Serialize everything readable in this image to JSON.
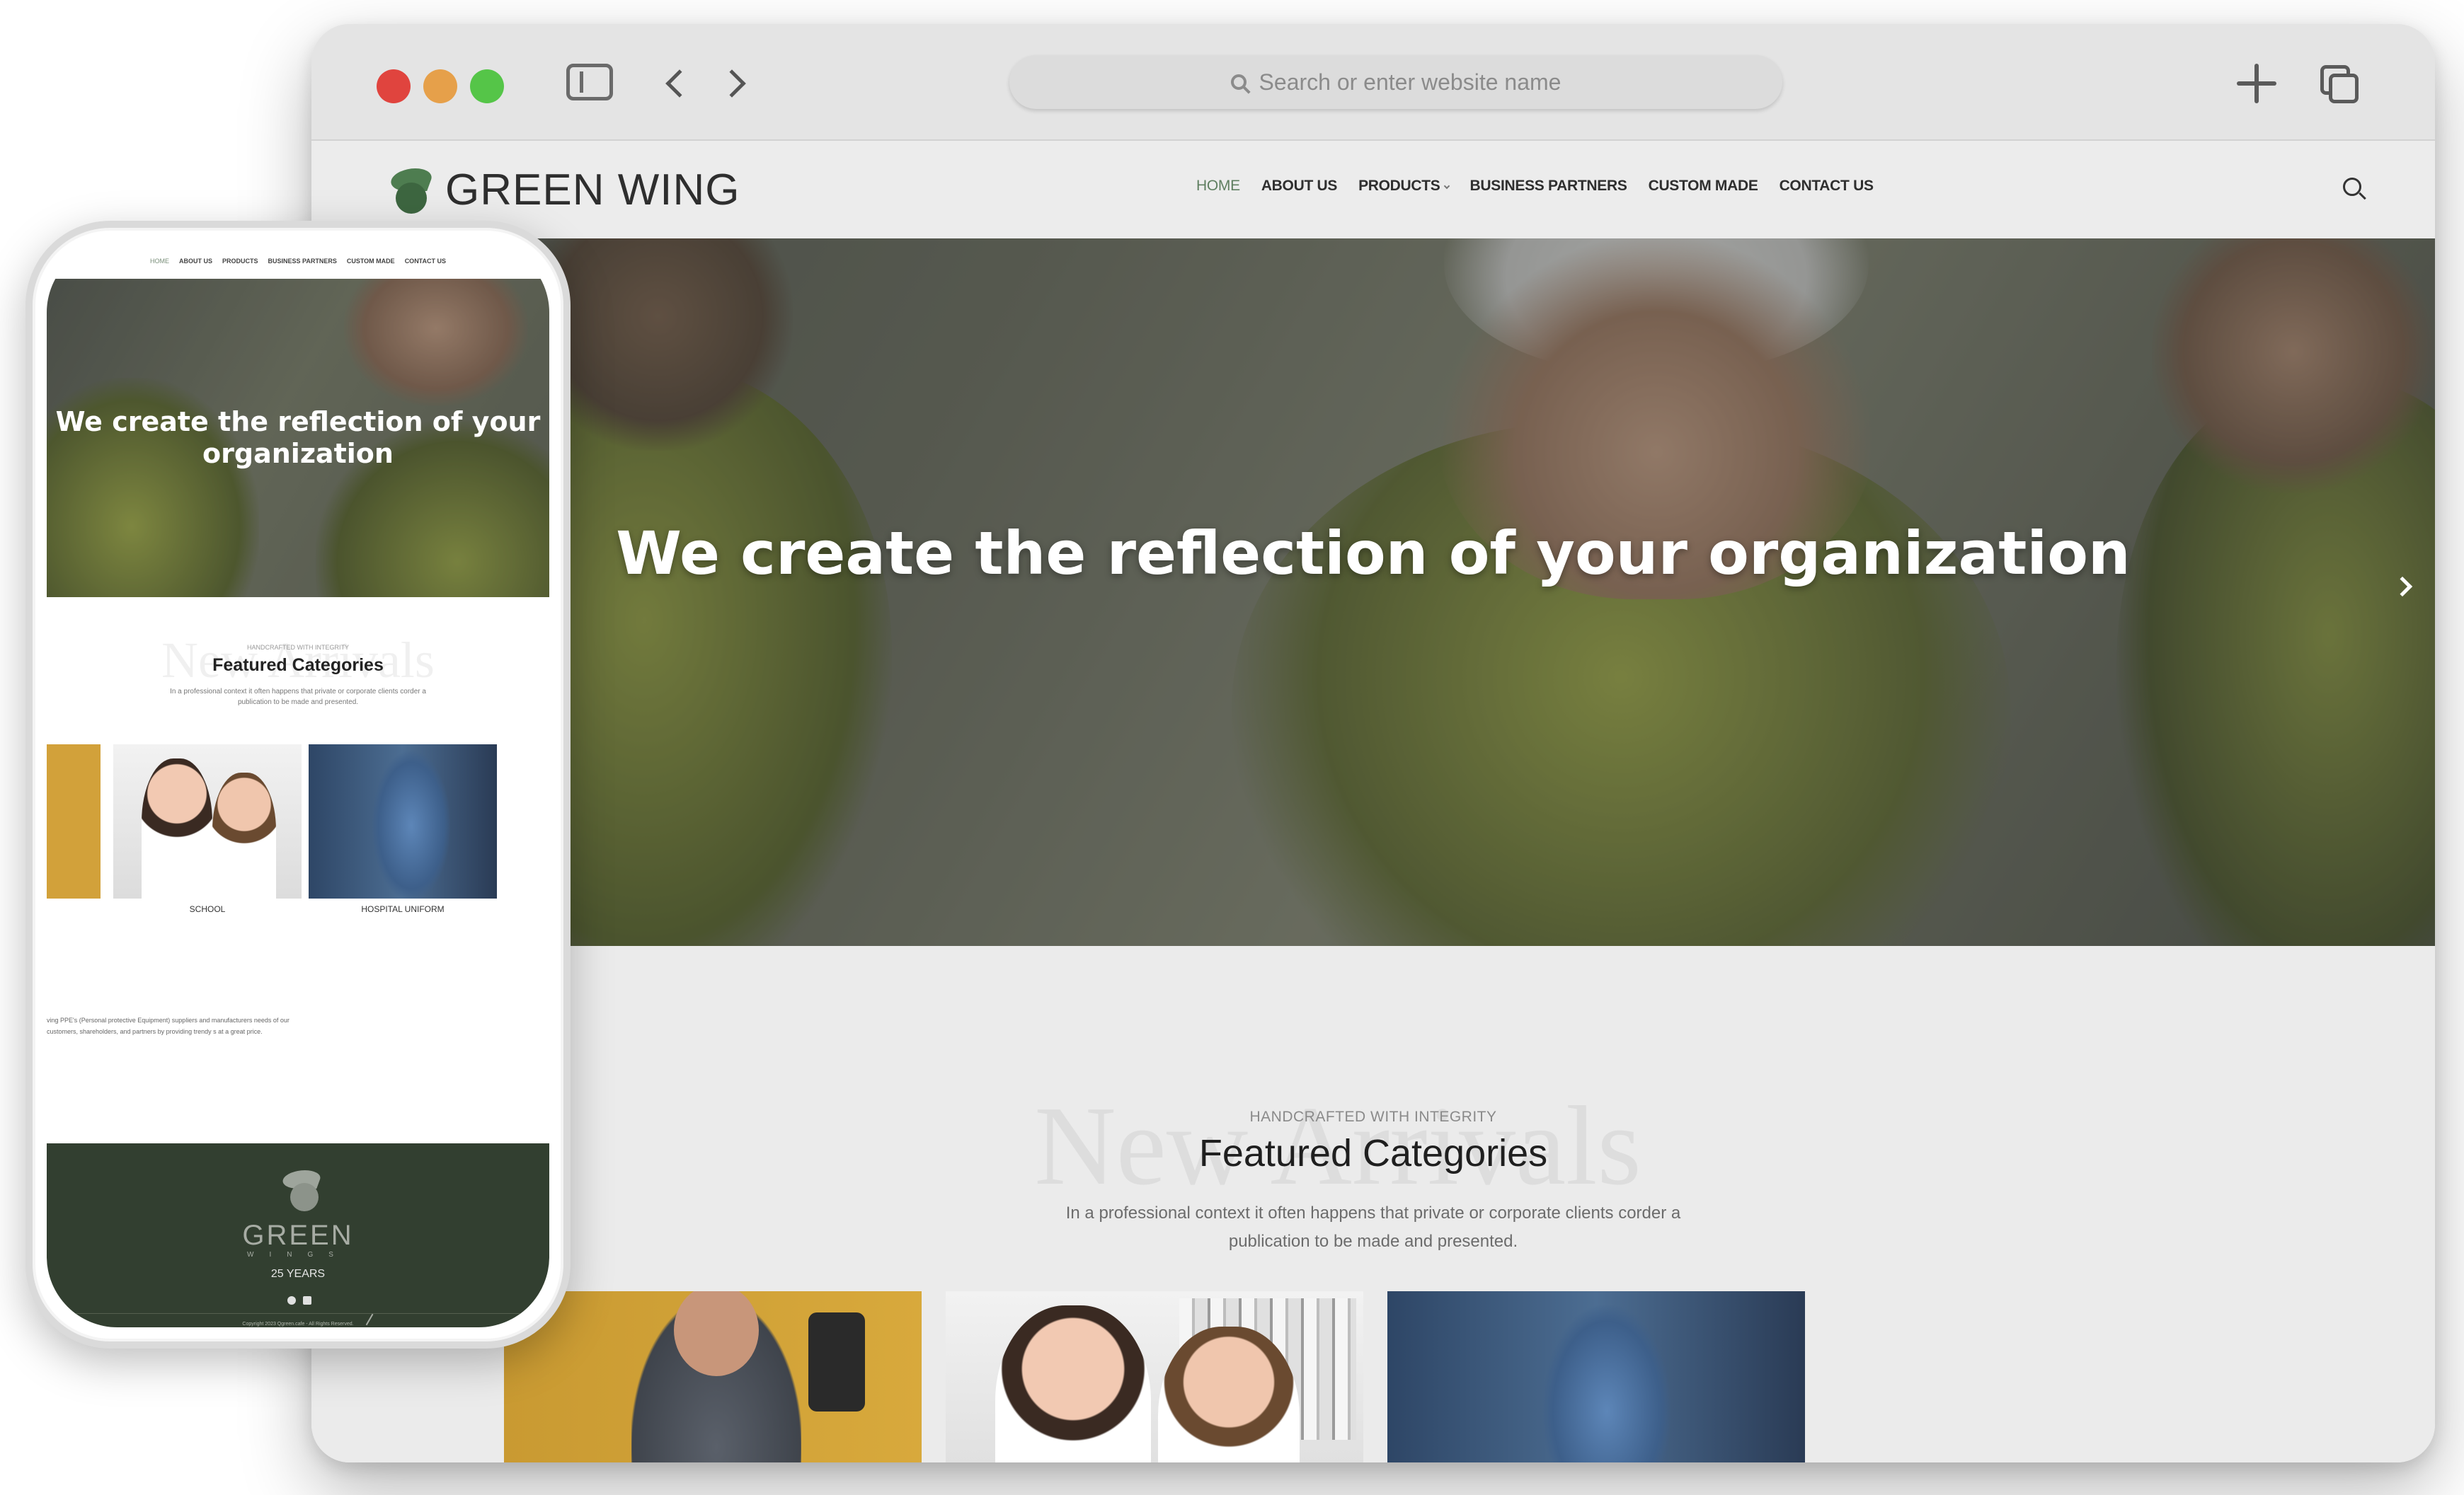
{
  "browser": {
    "url_placeholder": "Search or enter website name"
  },
  "site": {
    "logo_text": "GREEN WING",
    "nav": [
      {
        "label": "HOME",
        "active": true
      },
      {
        "label": "ABOUT US"
      },
      {
        "label": "PRODUCTS",
        "has_dropdown": true
      },
      {
        "label": "BUSINESS PARTNERS"
      },
      {
        "label": "CUSTOM MADE"
      },
      {
        "label": "CONTACT US"
      }
    ],
    "hero_title": "We create the reflection of your organization",
    "featured": {
      "ghost": "New Arrivals",
      "eyebrow": "HANDCRAFTED WITH INTEGRITY",
      "title": "Featured Categories",
      "description": "In a professional context it often happens that private or corporate clients corder a publication to be made and presented."
    },
    "categories": [
      {
        "label": "SCHOOL"
      },
      {
        "label": "HOSPITAL UNIFORM"
      }
    ],
    "about_text": "ving PPE's (Personal protective Equipment) suppliers and manufacturers needs of our customers, shareholders, and partners by providing trendy s at a great price.",
    "footer": {
      "logo_name": "GREEN",
      "logo_sub": "WINGS",
      "years": "25 YEARS",
      "copyright": "Copyright 2023 Qgreen.cafe - All Rights Reserved."
    }
  },
  "colors": {
    "accent": "#5f7f60",
    "footer_bg": "#323f30",
    "traffic_red": "#e0443e",
    "traffic_yellow": "#e6a04a",
    "traffic_green": "#55c548"
  }
}
